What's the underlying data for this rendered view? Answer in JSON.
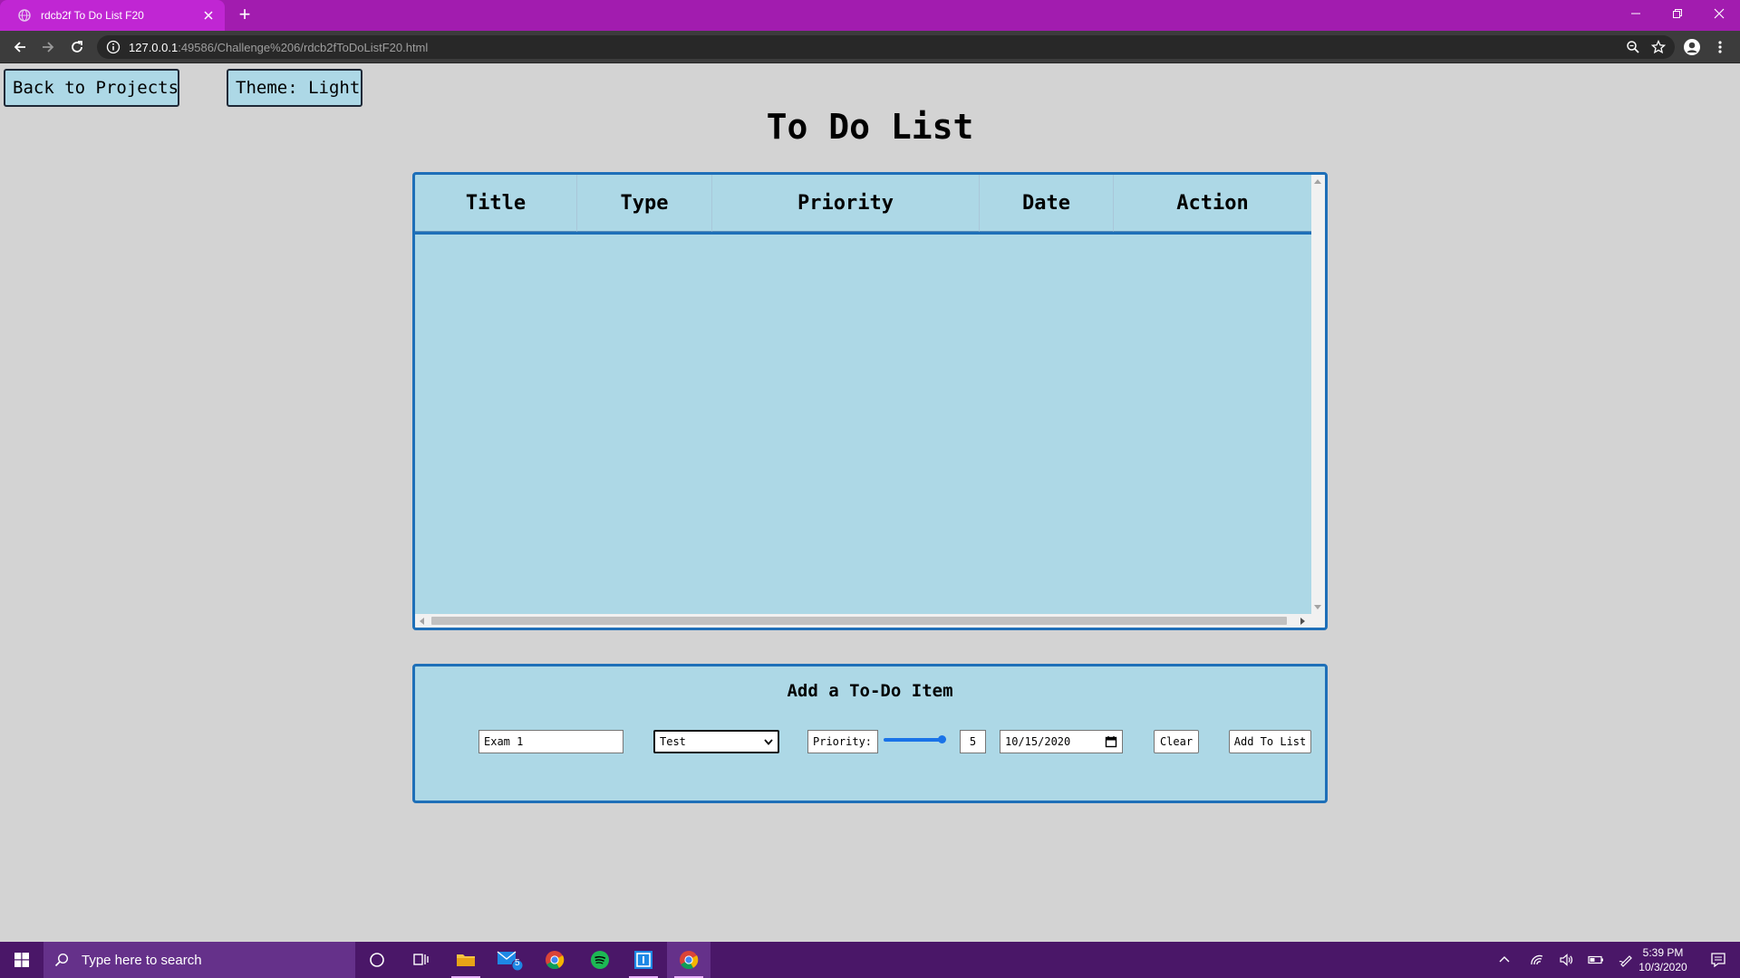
{
  "browser": {
    "tab_title": "rdcb2f To Do List F20",
    "url_host": "127.0.0.1",
    "url_rest": ":49586/Challenge%206/rdcb2fToDoListF20.html"
  },
  "page": {
    "back_button": "Back to Projects",
    "theme_button": "Theme: Light",
    "heading": "To Do List",
    "table": {
      "columns": [
        "Title",
        "Type",
        "Priority",
        "Date",
        "Action"
      ],
      "rows": []
    },
    "form": {
      "title": "Add a To-Do Item",
      "title_value": "Exam 1",
      "type_selected": "Test",
      "priority_label": "Priority:",
      "priority_value": "5",
      "priority_slider_fraction": 1.0,
      "date_value": "10/15/2020",
      "clear_button": "Clear",
      "add_button": "Add To List"
    }
  },
  "taskbar": {
    "search_placeholder": "Type here to search",
    "mail_badge": "5",
    "time": "5:39 PM",
    "date": "10/3/2020"
  },
  "colors": {
    "tab_strip": "#a21caf",
    "page_bg": "#d3d3d3",
    "panel_bg": "#add8e6",
    "panel_border": "#1e6fb8",
    "taskbar": "#4a1768"
  }
}
